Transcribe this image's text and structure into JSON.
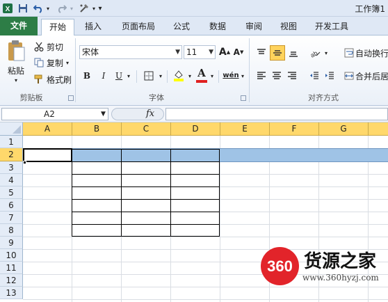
{
  "window": {
    "title": "工作簿1",
    "qat": {
      "app_icon": "excel-icon",
      "save_icon": "save-icon",
      "undo_icon": "undo-icon",
      "redo_icon": "redo-icon",
      "tool_icon": "format-tool-icon",
      "customize_icon": "customize-qat-icon"
    }
  },
  "tabs": [
    "文件",
    "开始",
    "插入",
    "页面布局",
    "公式",
    "数据",
    "审阅",
    "视图",
    "开发工具"
  ],
  "ribbon": {
    "clipboard": {
      "paste": "粘贴",
      "cut": "剪切",
      "copy": "复制",
      "format_painter": "格式刷",
      "label": "剪贴板"
    },
    "font": {
      "name": "宋体",
      "size": "11",
      "grow": "A",
      "shrink": "A",
      "bold": "B",
      "italic": "I",
      "underline": "U",
      "font_color_glyph": "A",
      "phonetic": "wén",
      "label": "字体",
      "fill_color": "#ffff00",
      "font_color": "#e02020"
    },
    "alignment": {
      "wrap_text": "自动换行",
      "merge_center": "合并后居",
      "label": "对齐方式"
    }
  },
  "formula_bar": {
    "name_box": "A2",
    "fx": "fx",
    "content": ""
  },
  "sheet": {
    "columns": [
      "A",
      "B",
      "C",
      "D",
      "E",
      "F",
      "G"
    ],
    "rows": [
      "1",
      "2",
      "3",
      "4",
      "5",
      "6",
      "7",
      "8",
      "9",
      "10",
      "11",
      "12",
      "13"
    ],
    "selected_row": "2",
    "active_cell": "A2",
    "selection_color": "#9fc3e6",
    "header_highlight": "#ffd86b"
  },
  "watermark": {
    "badge": "360",
    "title": "货源之家",
    "url": "www.360hyzj.com"
  }
}
